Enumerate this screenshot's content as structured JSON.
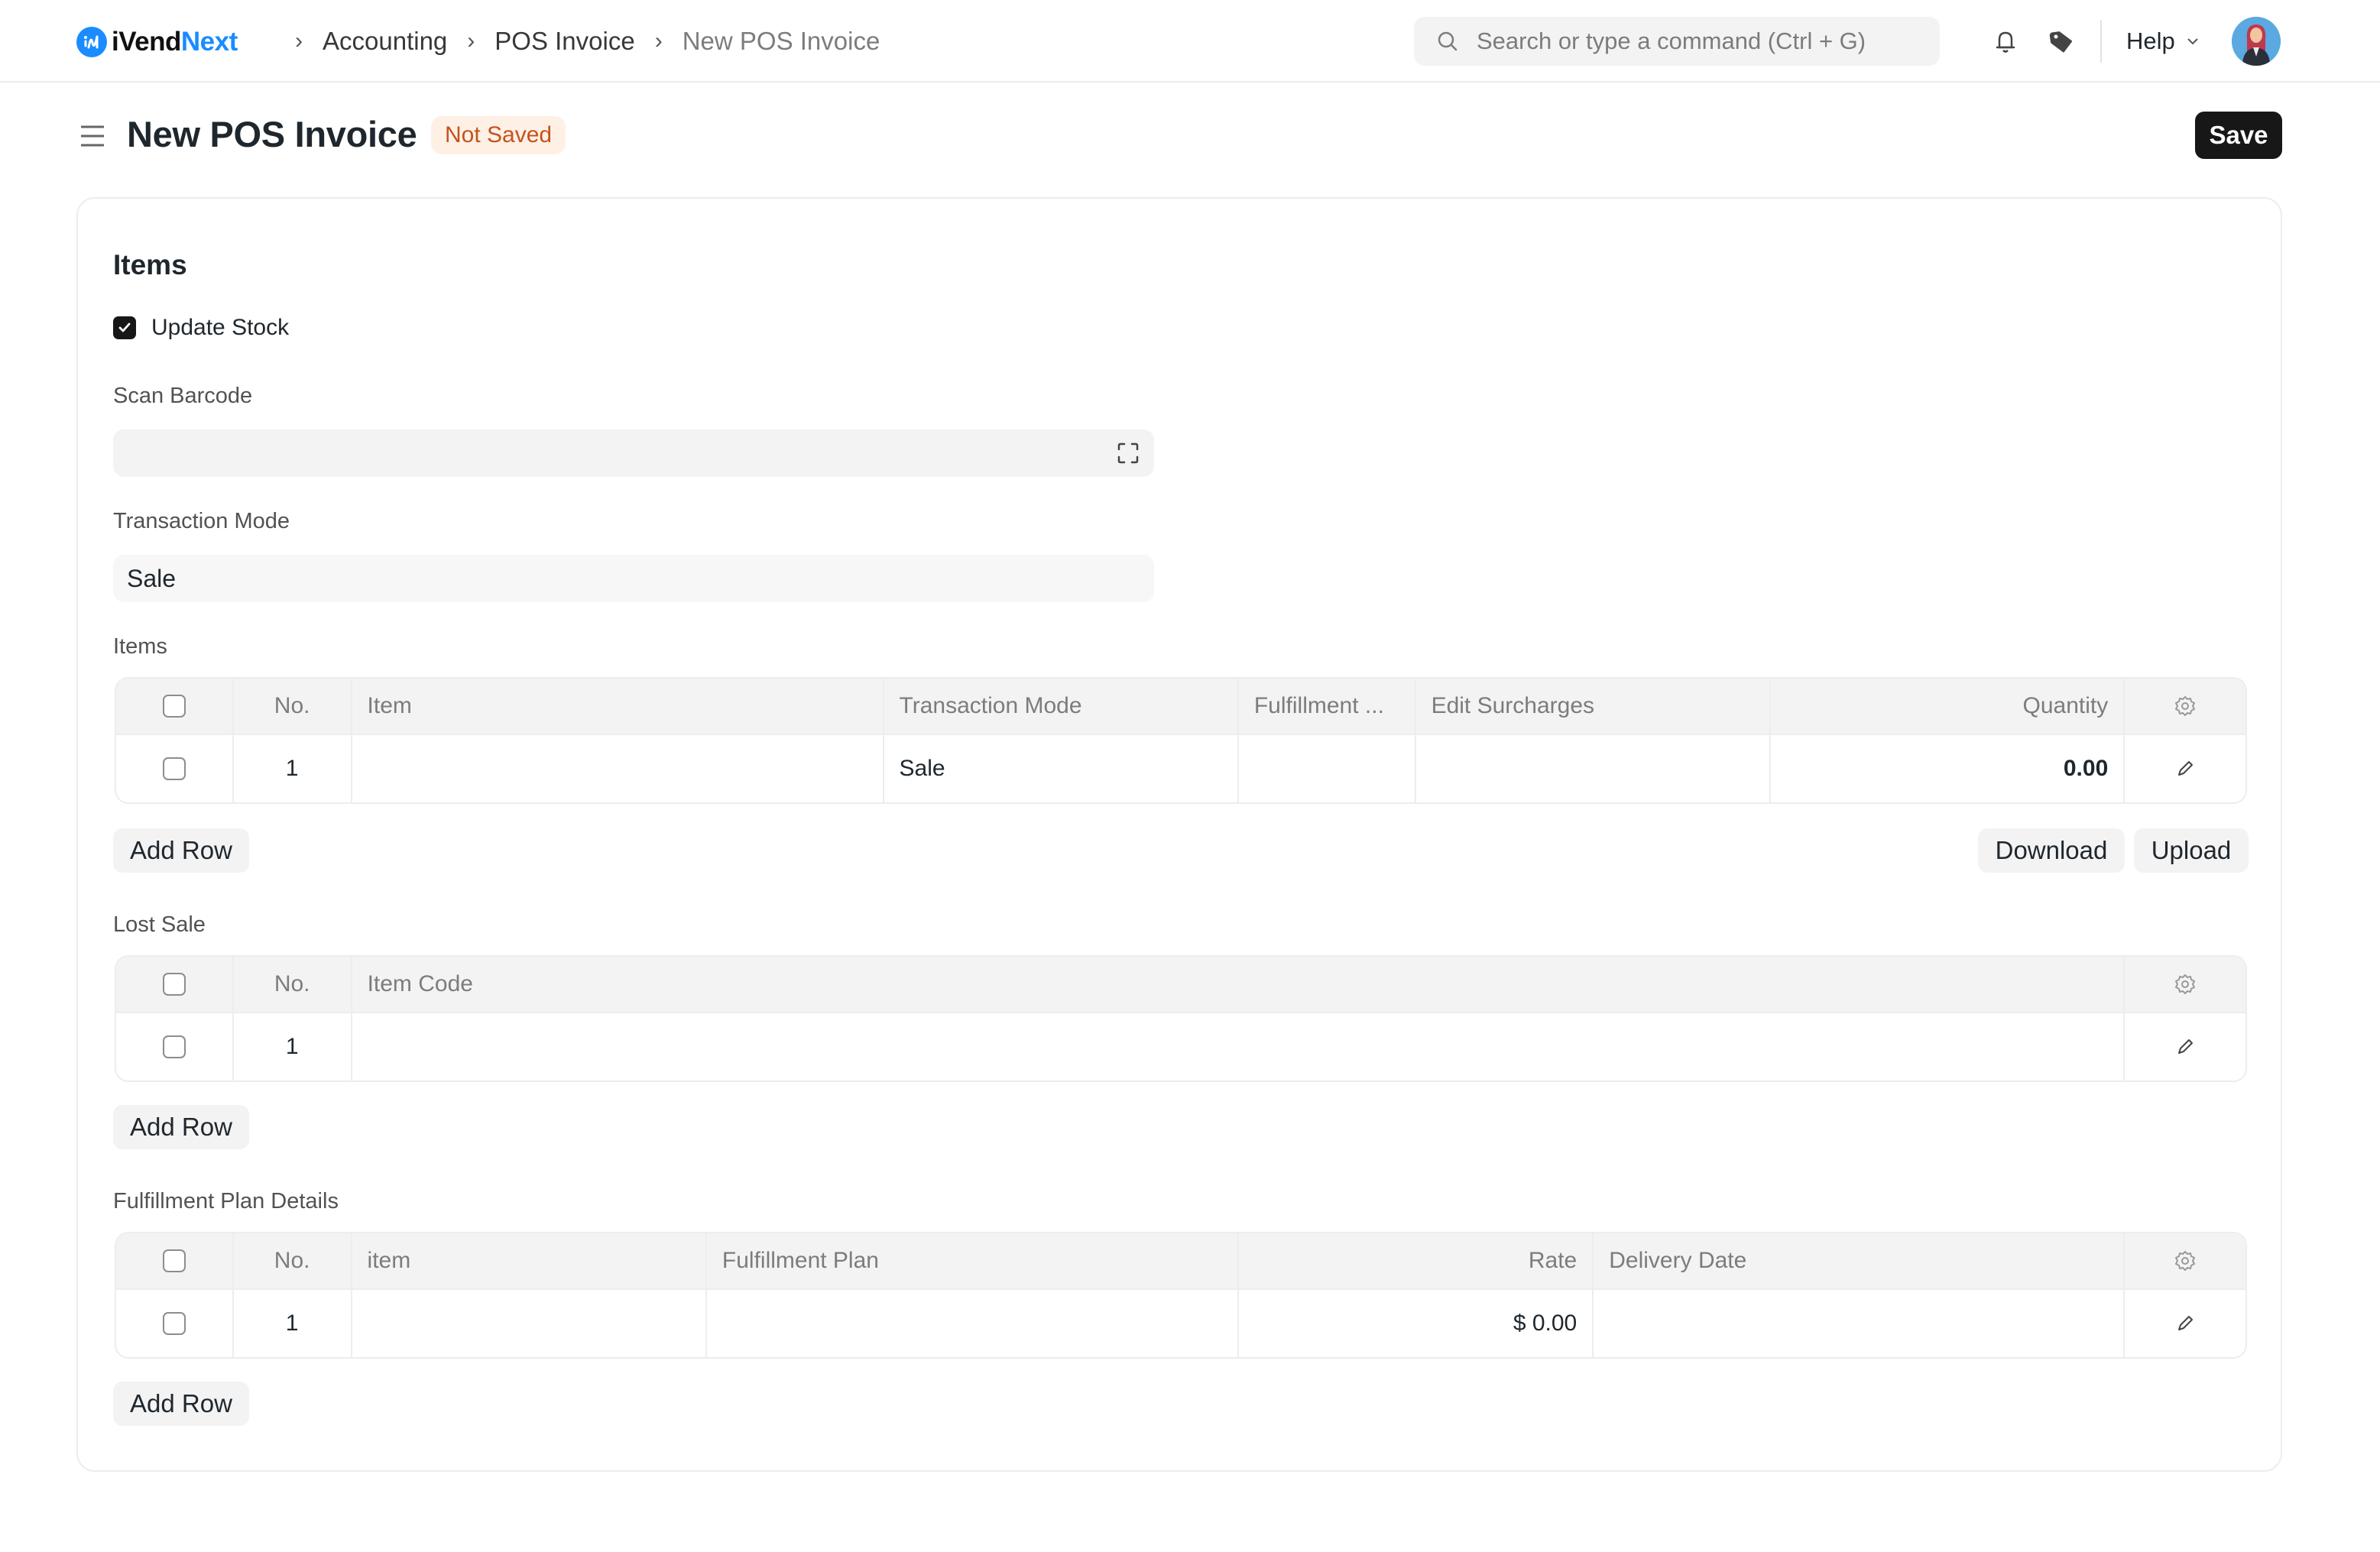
{
  "navbar": {
    "logo": {
      "part1": "iVend",
      "part2": "Next",
      "brand_color": "#1a8cff"
    },
    "breadcrumbs": [
      {
        "label": "Accounting"
      },
      {
        "label": "POS Invoice"
      },
      {
        "label": "New POS Invoice"
      }
    ],
    "search": {
      "placeholder": "Search or type a command (Ctrl + G)",
      "icon": "search-icon"
    },
    "icons": [
      "bell-icon",
      "tag-icon"
    ],
    "help_label": "Help",
    "avatar": "user-avatar"
  },
  "page": {
    "title": "New POS Invoice",
    "status_badge": "Not Saved",
    "save_label": "Save"
  },
  "form": {
    "section_title": "Items",
    "update_stock": {
      "label": "Update Stock",
      "checked": true
    },
    "scan_barcode": {
      "label": "Scan Barcode",
      "value": ""
    },
    "transaction_mode": {
      "label": "Transaction Mode",
      "value": "Sale"
    },
    "items_table": {
      "label": "Items",
      "columns": [
        "No.",
        "Item",
        "Transaction Mode",
        "Fulfillment ...",
        "Edit Surcharges",
        "Quantity"
      ],
      "rows": [
        {
          "no": "1",
          "item": "",
          "transaction_mode": "Sale",
          "fulfillment": "",
          "edit_surcharges": "",
          "quantity": "0.00"
        }
      ],
      "add_row_label": "Add Row",
      "download_label": "Download",
      "upload_label": "Upload"
    },
    "lost_sale_table": {
      "label": "Lost Sale",
      "columns": [
        "No.",
        "Item Code"
      ],
      "rows": [
        {
          "no": "1",
          "item_code": ""
        }
      ],
      "add_row_label": "Add Row"
    },
    "fulfillment_table": {
      "label": "Fulfillment Plan Details",
      "columns": [
        "No.",
        "item",
        "Fulfillment Plan",
        "Rate",
        "Delivery Date"
      ],
      "rows": [
        {
          "no": "1",
          "item": "",
          "fulfillment_plan": "",
          "rate": "$ 0.00",
          "delivery_date": ""
        }
      ],
      "add_row_label": "Add Row"
    }
  },
  "colors": {
    "accent": "#1a8cff",
    "primary_button": "#171717",
    "badge_bg": "#fff0e6",
    "badge_text": "#c4531a"
  }
}
